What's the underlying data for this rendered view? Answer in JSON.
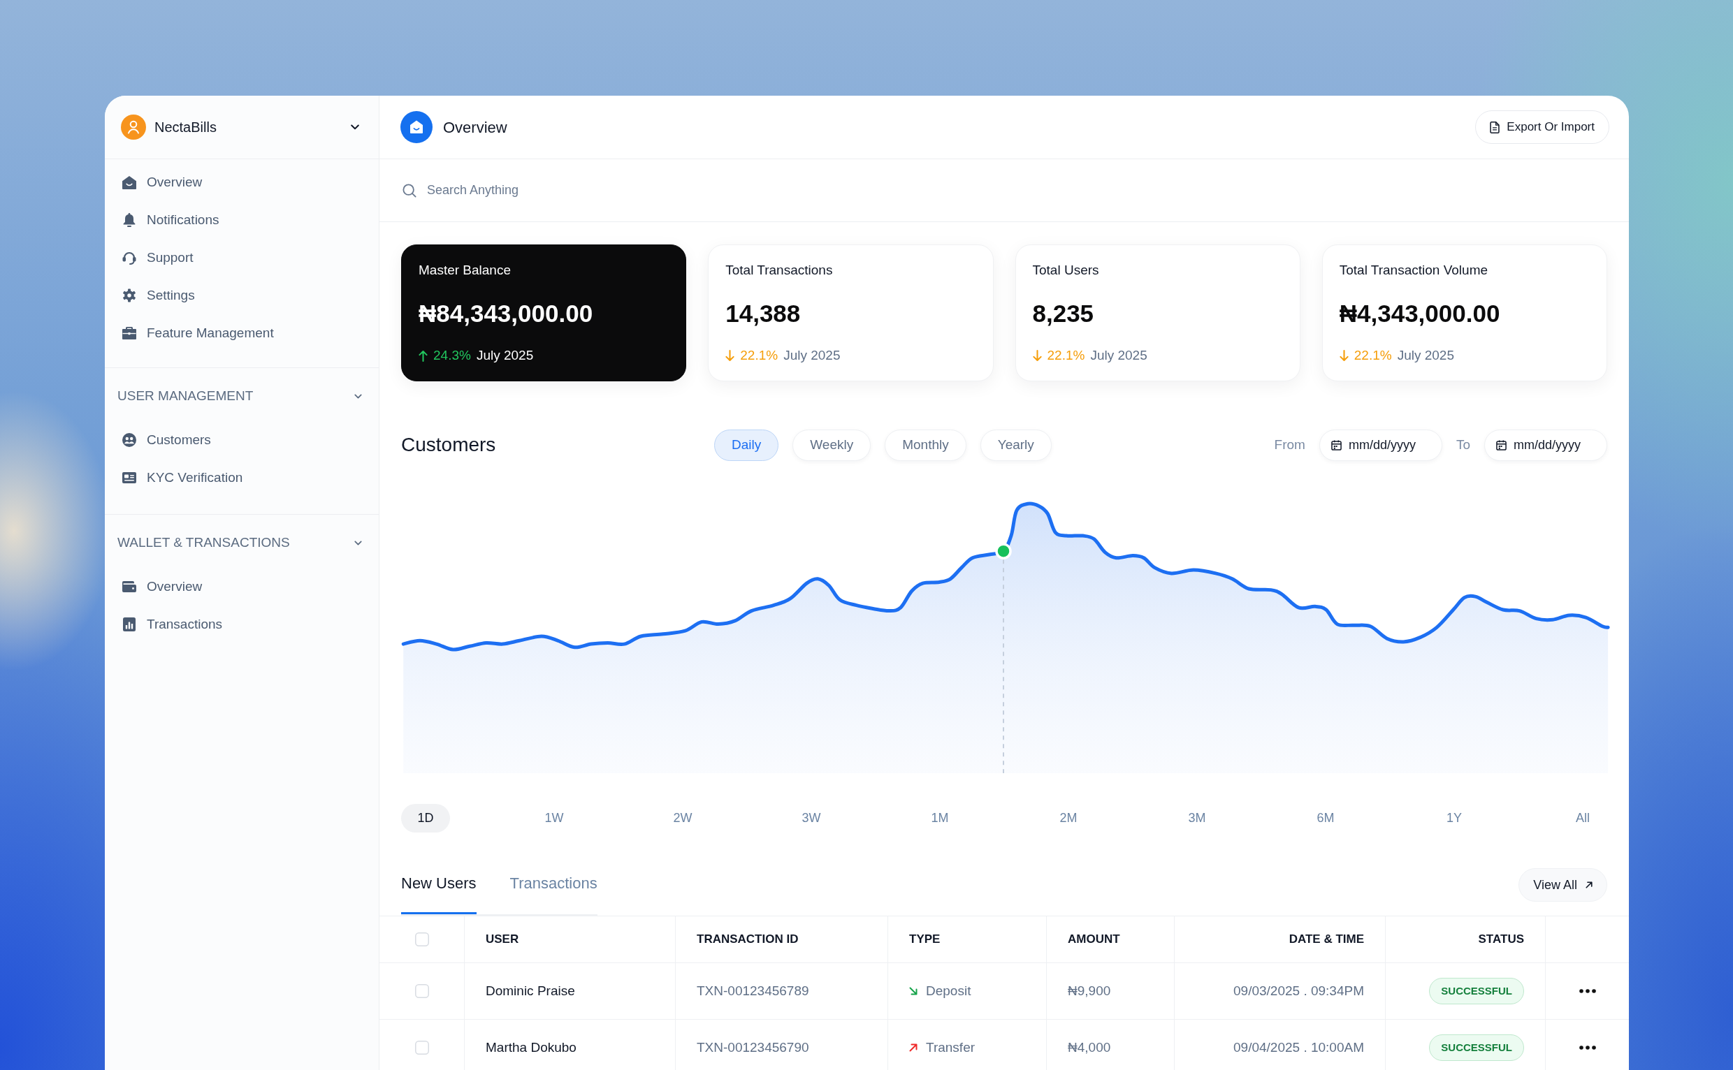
{
  "sidebar": {
    "workspace": {
      "name": "NectaBills"
    },
    "items": [
      {
        "label": "Overview"
      },
      {
        "label": "Notifications"
      },
      {
        "label": "Support"
      },
      {
        "label": "Settings"
      },
      {
        "label": "Feature Management"
      }
    ],
    "sections": [
      {
        "title": "USER MANAGEMENT",
        "expanded": true,
        "items": [
          {
            "label": "Customers"
          },
          {
            "label": "KYC Verification"
          }
        ]
      },
      {
        "title": "WALLET & TRANSACTIONS",
        "expanded": true,
        "items": [
          {
            "label": "Overview"
          },
          {
            "label": "Transactions"
          }
        ]
      }
    ]
  },
  "header": {
    "title": "Overview",
    "export_button": "Export Or Import"
  },
  "search": {
    "placeholder": "Search Anything"
  },
  "stat_cards": [
    {
      "kind": "featured",
      "title": "Master Balance",
      "value": "₦84,343,000.00",
      "rising": true,
      "change": "24.3%",
      "period": "July 2025"
    },
    {
      "kind": "plain",
      "title": "Total Transactions",
      "value": "14,388",
      "rising": false,
      "change": "22.1%",
      "period": "July 2025"
    },
    {
      "kind": "plain",
      "title": "Total Users",
      "value": "8,235",
      "rising": false,
      "change": "22.1%",
      "period": "July 2025"
    },
    {
      "kind": "plain",
      "title": "Total Transaction Volume",
      "value": "₦4,343,000.00",
      "rising": false,
      "change": "22.1%",
      "period": "July 2025"
    }
  ],
  "customers": {
    "title": "Customers",
    "periods": [
      {
        "label": "Daily",
        "selected": true
      },
      {
        "label": "Weekly",
        "selected": false
      },
      {
        "label": "Monthly",
        "selected": false
      },
      {
        "label": "Yearly",
        "selected": false
      }
    ],
    "date_range": {
      "from_label": "From",
      "from": {
        "placeholder": "mm/dd/yyyy"
      },
      "to_label": "To",
      "to": {
        "placeholder": "mm/dd/yyyy"
      }
    },
    "ranges": [
      {
        "label": "1D",
        "selected": true
      },
      {
        "label": "1W",
        "selected": false
      },
      {
        "label": "2W",
        "selected": false
      },
      {
        "label": "3W",
        "selected": false
      },
      {
        "label": "1M",
        "selected": false
      },
      {
        "label": "2M",
        "selected": false
      },
      {
        "label": "3M",
        "selected": false
      },
      {
        "label": "6M",
        "selected": false
      },
      {
        "label": "1Y",
        "selected": false
      },
      {
        "label": "All",
        "selected": false
      }
    ]
  },
  "activity": {
    "tabs": [
      {
        "label": "New Users",
        "selected": true
      },
      {
        "label": "Transactions",
        "selected": false
      }
    ],
    "view_all_button": "View All",
    "table": {
      "select_all_checked": false,
      "columns": [
        "USER",
        "TRANSACTION ID",
        "TYPE",
        "AMOUNT",
        "DATE & TIME",
        "STATUS"
      ],
      "rows": [
        {
          "checked": false,
          "user": "Dominic Praise",
          "transaction_id": "TXN-00123456789",
          "type": {
            "label": "Deposit",
            "kind": "incoming"
          },
          "amount": "₦9,900",
          "date_time": "09/03/2025 . 09:34PM",
          "status": {
            "label": "SUCCESSFUL",
            "kind": "success"
          }
        },
        {
          "checked": false,
          "user": "Martha Dokubo",
          "transaction_id": "TXN-00123456790",
          "type": {
            "label": "Transfer",
            "kind": "outgoing"
          },
          "amount": "₦4,000",
          "date_time": "09/04/2025 . 10:00AM",
          "status": {
            "label": "SUCCESSFUL",
            "kind": "success"
          }
        }
      ]
    }
  }
}
